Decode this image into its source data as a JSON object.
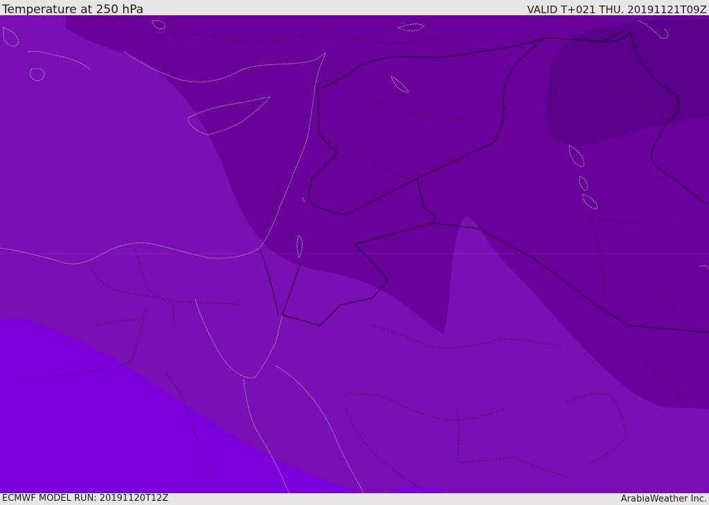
{
  "header": {
    "title": "Temperature at 250 hPa",
    "valid_time": "VALID T+021 THU. 20191121T09Z"
  },
  "footer": {
    "model_run": "ECMWF MODEL RUN: 20191120T12Z",
    "credit": "ArabiaWeather Inc."
  },
  "colors": {
    "band_warmest": "#7c00dc",
    "band_mid": "#7a10b4",
    "band_cool": "#680099",
    "band_coldest": "#58008a",
    "international_border": "#111111",
    "coastline": "#aaaaaa",
    "admin_border": "#222222"
  }
}
